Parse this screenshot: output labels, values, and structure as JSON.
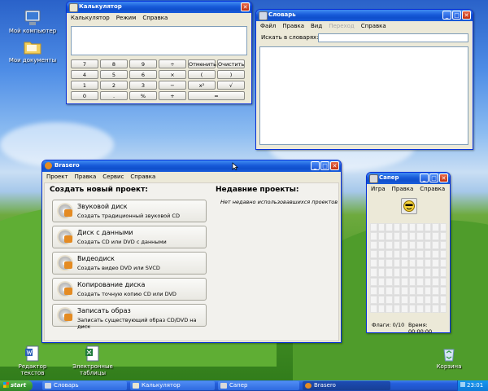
{
  "desktop": {
    "icons": [
      {
        "label": "Мой компьютер"
      },
      {
        "label": "Мои документы"
      },
      {
        "label": "Редактор текстов"
      },
      {
        "label": "Электронные таблицы"
      },
      {
        "label": "Корзина"
      }
    ]
  },
  "calculator": {
    "title": "Калькулятор",
    "menu": [
      "Калькулятор",
      "Режим",
      "Справка"
    ],
    "display_value": "",
    "keys": [
      [
        "7",
        "8",
        "9",
        "÷",
        "Отменить",
        "Очистить"
      ],
      [
        "4",
        "5",
        "6",
        "×",
        "(",
        ")"
      ],
      [
        "1",
        "2",
        "3",
        "−",
        "x²",
        "√"
      ],
      [
        "0",
        ".",
        "%",
        "+",
        "="
      ]
    ]
  },
  "dictionary": {
    "title": "Словарь",
    "menu": [
      "Файл",
      "Правка",
      "Вид",
      "Переход",
      "Справка"
    ],
    "search_label": "Искать в словарях:",
    "search_value": ""
  },
  "brasero": {
    "title": "Brasero",
    "menu": [
      "Проект",
      "Правка",
      "Сервис",
      "Справка"
    ],
    "new_project_heading": "Создать новый проект:",
    "recent_heading": "Недавние проекты:",
    "recent_empty": "Нет недавно использовавшихся проектов",
    "projects": [
      {
        "title": "Звуковой диск",
        "subtitle": "Создать традиционный звуковой CD"
      },
      {
        "title": "Диск с данными",
        "subtitle": "Создать CD или DVD с данными"
      },
      {
        "title": "Видеодиск",
        "subtitle": "Создать видео DVD или SVCD"
      },
      {
        "title": "Копирование диска",
        "subtitle": "Создать точную копию CD или DVD"
      },
      {
        "title": "Записать образ",
        "subtitle": "Записать существующий образ CD/DVD на диск"
      }
    ]
  },
  "minesweeper": {
    "title": "Сапер",
    "menu": [
      "Игра",
      "Правка",
      "Справка"
    ],
    "flags": "Флаги: 0/10",
    "time": "Время: 00:00:00"
  },
  "taskbar": {
    "start_label": "start",
    "buttons": [
      "Словарь",
      "Калькулятор",
      "Сапер",
      "Brasero"
    ],
    "clock": "23:01"
  },
  "colors": {
    "titlebar": "#0f4fcc",
    "window_bg": "#ece9d8",
    "taskbar": "#245edb",
    "start": "#3c9a34"
  }
}
